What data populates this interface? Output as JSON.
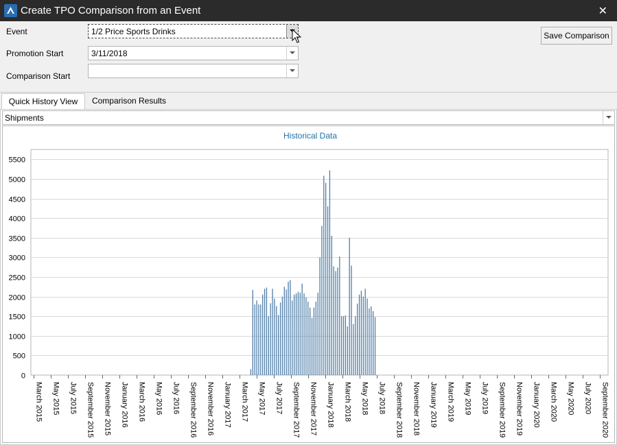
{
  "window": {
    "title": "Create TPO Comparison from an Event",
    "close_glyph": "✕"
  },
  "form": {
    "event_label": "Event",
    "event_value": "1/2 Price Sports Drinks",
    "promotion_start_label": "Promotion Start",
    "promotion_start_value": "3/11/2018",
    "comparison_start_label": "Comparison Start",
    "comparison_start_value": "",
    "save_button": "Save Comparison"
  },
  "tabs": [
    {
      "label": "Quick History View",
      "active": true
    },
    {
      "label": "Comparison Results",
      "active": false
    }
  ],
  "series_selector": {
    "value": "Shipments"
  },
  "colors": {
    "bar": "#4f7ea8",
    "title": "#1f6fa8",
    "grid": "#d8d8d8"
  },
  "chart_data": {
    "type": "bar",
    "title": "Historical Data",
    "ylim": [
      0,
      5750
    ],
    "yticks": [
      0,
      500,
      1000,
      1500,
      2000,
      2500,
      3000,
      3500,
      4000,
      4500,
      5000,
      5500
    ],
    "x_tick_labels": [
      "March 2015",
      "May 2015",
      "July 2015",
      "September 2015",
      "November 2015",
      "January 2016",
      "March 2016",
      "May 2016",
      "July 2016",
      "September 2016",
      "November 2016",
      "January 2017",
      "March 2017",
      "May 2017",
      "July 2017",
      "September 2017",
      "November 2017",
      "January 2018",
      "March 2018",
      "May 2018",
      "July 2018",
      "September 2018",
      "November 2018",
      "January 2019",
      "March 2019",
      "May 2019",
      "July 2019",
      "September 2019",
      "November 2019",
      "January 2020",
      "March 2020",
      "May 2020",
      "July 2020",
      "September 2020"
    ],
    "x_start": "March 2015",
    "x_end": "September 2020",
    "week_start": "2017-04-09",
    "weekly_values": [
      150,
      2170,
      1800,
      1900,
      1800,
      1800,
      2050,
      2200,
      2230,
      1500,
      1830,
      2200,
      1950,
      1760,
      1530,
      1850,
      2000,
      2250,
      2180,
      2380,
      2420,
      1900,
      2050,
      2080,
      2120,
      2100,
      2330,
      2080,
      1980,
      1870,
      1720,
      1460,
      1720,
      1870,
      2100,
      3000,
      3800,
      5080,
      4900,
      4300,
      5220,
      3550,
      2770,
      2650,
      2740,
      3020,
      1500,
      1500,
      1520,
      1240,
      3500,
      2790,
      1300,
      1500,
      1820,
      2050,
      2150,
      2000,
      2200,
      1950,
      1700,
      1750,
      1630,
      1480
    ],
    "grid": true
  }
}
